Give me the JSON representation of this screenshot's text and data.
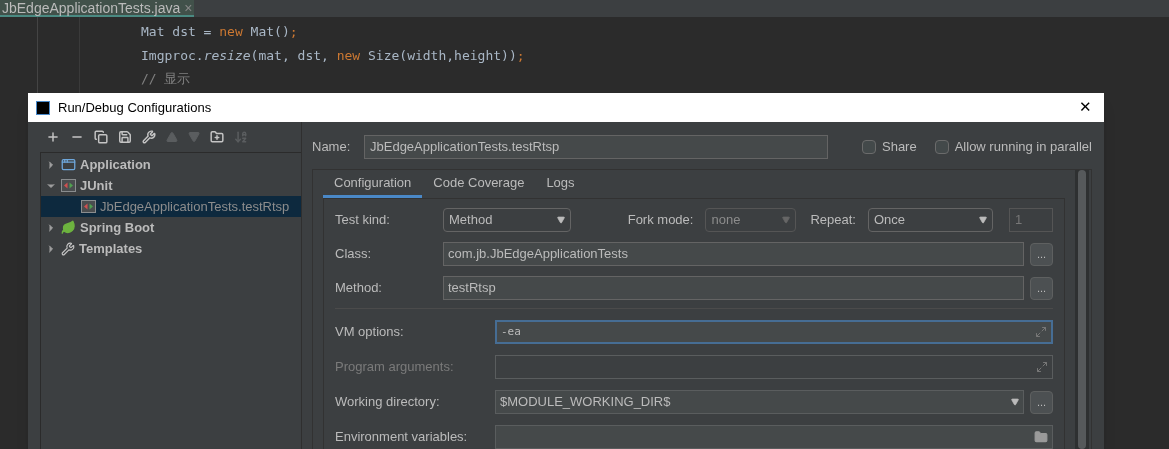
{
  "editor": {
    "tab": {
      "label": "JbEdgeApplicationTests.java",
      "close": "×"
    },
    "code_lines": [
      [
        {
          "text": "Mat dst = ",
          "kind": "plain"
        },
        {
          "text": "new ",
          "kind": "keyword"
        },
        {
          "text": "Mat()",
          "kind": "plain"
        },
        {
          "text": ";",
          "kind": "keyword"
        }
      ],
      [
        {
          "text": "Imgproc.",
          "kind": "plain"
        },
        {
          "text": "resize",
          "kind": "italic"
        },
        {
          "text": "(mat, dst, ",
          "kind": "plain"
        },
        {
          "text": "new ",
          "kind": "keyword"
        },
        {
          "text": "Size(width,height))",
          "kind": "plain"
        },
        {
          "text": ";",
          "kind": "keyword"
        }
      ],
      [
        {
          "text": "// 显示",
          "kind": "comment"
        }
      ]
    ]
  },
  "dialog": {
    "title": "Run/Debug Configurations",
    "close": "✕",
    "toolbar": [
      {
        "kind": "plus",
        "disabled": false
      },
      {
        "kind": "minus",
        "disabled": false
      },
      {
        "kind": "copy",
        "disabled": false
      },
      {
        "kind": "save",
        "disabled": false
      },
      {
        "kind": "wrench",
        "disabled": false
      },
      {
        "kind": "up",
        "disabled": true
      },
      {
        "kind": "down",
        "disabled": true
      },
      {
        "kind": "folder",
        "disabled": false
      },
      {
        "kind": "sort",
        "disabled": true
      }
    ],
    "tree": [
      {
        "label": "Application",
        "kind": "application",
        "expanded": false,
        "selected": false
      },
      {
        "label": "JUnit",
        "kind": "junit",
        "expanded": true,
        "selected": false,
        "children": [
          {
            "label": "JbEdgeApplicationTests.testRtsp",
            "kind": "junit",
            "selected": true
          }
        ]
      },
      {
        "label": "Spring Boot",
        "kind": "spring",
        "expanded": false,
        "selected": false
      },
      {
        "label": "Templates",
        "kind": "wrench",
        "expanded": false,
        "selected": false
      }
    ],
    "name": {
      "label": "Name:",
      "value": "JbEdgeApplicationTests.testRtsp"
    },
    "options": [
      {
        "label": "Share",
        "checked": false
      },
      {
        "label": "Allow running in parallel",
        "checked": false
      }
    ],
    "tabs": [
      {
        "label": "Configuration",
        "selected": true
      },
      {
        "label": "Code Coverage",
        "selected": false
      },
      {
        "label": "Logs",
        "selected": false
      }
    ],
    "test_kind": {
      "label": "Test kind:",
      "value": "Method"
    },
    "fork_mode": {
      "label": "Fork mode:",
      "value": "none",
      "disabled": true
    },
    "repeat": {
      "label": "Repeat:",
      "value": "Once",
      "count": "1"
    },
    "class_rows": [
      {
        "label": "Class:",
        "value": "com.jb.JbEdgeApplicationTests",
        "browse": "..."
      },
      {
        "label": "Method:",
        "value": "testRtsp",
        "browse": "..."
      }
    ],
    "option_rows": [
      {
        "label": "VM options:",
        "value": "-ea",
        "kind": "expand",
        "disabled": false,
        "focused": true
      },
      {
        "label": "Program arguments:",
        "kind": "expand",
        "disabled": true,
        "focused": false
      },
      {
        "label": "Working directory:",
        "value": "$MODULE_WORKING_DIR$",
        "kind": "combo",
        "browse": "...",
        "disabled": false,
        "focused": false
      },
      {
        "label": "Environment variables:",
        "kind": "folder",
        "disabled": false,
        "focused": false
      }
    ]
  }
}
